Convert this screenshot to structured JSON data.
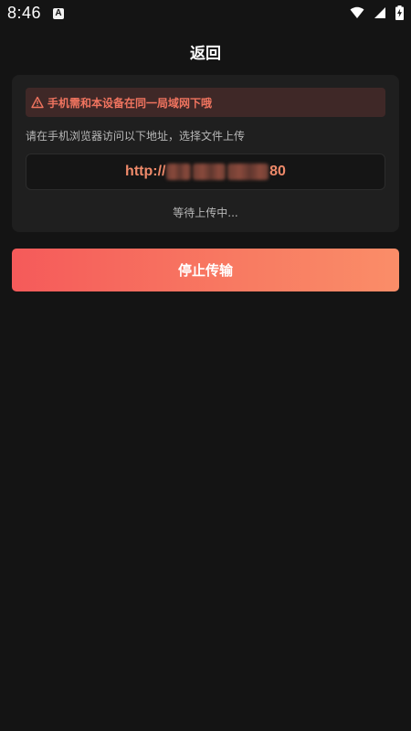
{
  "status_bar": {
    "time": "8:46",
    "a_icon": "A",
    "icons": [
      "wifi-icon",
      "signal-icon",
      "battery-charging-icon"
    ]
  },
  "header": {
    "title": "返回"
  },
  "card": {
    "warning": {
      "icon": "warning-triangle-icon",
      "text": "手机需和本设备在同一局域网下哦"
    },
    "instruction": "请在手机浏览器访问以下地址，选择文件上传",
    "url": {
      "prefix": "http://",
      "suffix": "80"
    },
    "waiting": "等待上传中..."
  },
  "stop_button": {
    "label": "停止传输"
  },
  "colors": {
    "background": "#141414",
    "card": "#1f1f1f",
    "accent": "#f0745f",
    "button_start": "#f55a5a",
    "button_end": "#fa8d68"
  }
}
